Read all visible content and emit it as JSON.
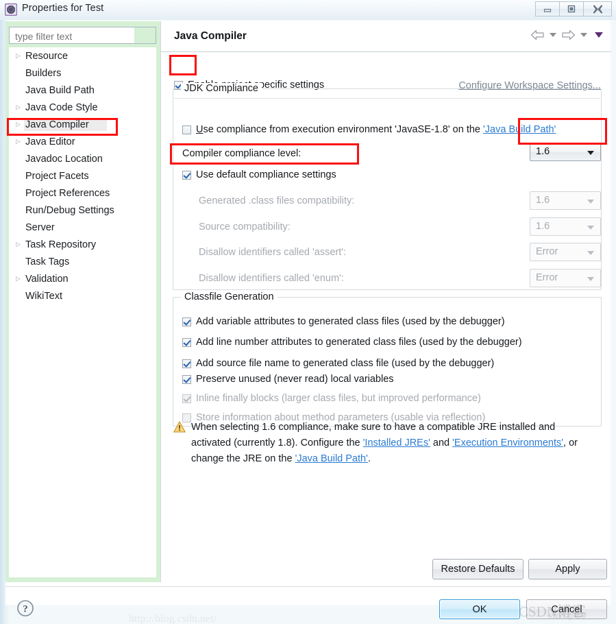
{
  "window": {
    "title": "Properties for Test",
    "icon": "eclipse-properties-icon",
    "minimize_label": "–",
    "maximize_label": "❐",
    "close_label": "✖"
  },
  "sidebar": {
    "filter": {
      "value": "",
      "placeholder": "type filter text"
    },
    "items": [
      {
        "label": "Resource",
        "expandable": true,
        "selected": false
      },
      {
        "label": "Builders",
        "expandable": false,
        "selected": false
      },
      {
        "label": "Java Build Path",
        "expandable": false,
        "selected": false
      },
      {
        "label": "Java Code Style",
        "expandable": true,
        "selected": false
      },
      {
        "label": "Java Compiler",
        "expandable": true,
        "selected": true
      },
      {
        "label": "Java Editor",
        "expandable": true,
        "selected": false
      },
      {
        "label": "Javadoc Location",
        "expandable": false,
        "selected": false
      },
      {
        "label": "Project Facets",
        "expandable": false,
        "selected": false
      },
      {
        "label": "Project References",
        "expandable": false,
        "selected": false
      },
      {
        "label": "Run/Debug Settings",
        "expandable": false,
        "selected": false
      },
      {
        "label": "Server",
        "expandable": false,
        "selected": false
      },
      {
        "label": "Task Repository",
        "expandable": true,
        "selected": false
      },
      {
        "label": "Task Tags",
        "expandable": false,
        "selected": false
      },
      {
        "label": "Validation",
        "expandable": true,
        "selected": false
      },
      {
        "label": "WikiText",
        "expandable": false,
        "selected": false
      }
    ]
  },
  "page": {
    "title": "Java Compiler",
    "enable_project_specific": {
      "label_pre": "E",
      "label_underline": "n",
      "label_post": "able project specific settings",
      "label_full": "Enable project specific settings",
      "checked": true
    },
    "configure_workspace_link": "Configure Workspace Settings..."
  },
  "jdk_compliance": {
    "group_title": "JDK Compliance",
    "use_execution_env": {
      "text_before": "se compliance from execution environment 'JavaSE-1.8' on the ",
      "underlined_first": "U",
      "link": "'Java Build Path'",
      "checked": false
    },
    "compiler_compliance_level": {
      "label": "Compiler compliance level:",
      "value": "1.6",
      "enabled": true
    },
    "use_default_compliance": {
      "label": "Use default compliance settings",
      "checked": true
    },
    "fields": [
      {
        "label": "Generated .class files compatibility:",
        "value": "1.6",
        "enabled": false
      },
      {
        "label": "Source compatibility:",
        "value": "1.6",
        "enabled": false
      },
      {
        "label": "Disallow identifiers called 'assert':",
        "value": "Error",
        "enabled": false
      },
      {
        "label": "Disallow identifiers called 'enum':",
        "value": "Error",
        "enabled": false
      }
    ]
  },
  "classfile_generation": {
    "group_title": "Classfile Generation",
    "options": [
      {
        "label": "Add variable attributes to generated class files (used by the debugger)",
        "checked": true,
        "enabled": true
      },
      {
        "label": "Add line number attributes to generated class files (used by the debugger)",
        "checked": true,
        "enabled": true
      },
      {
        "label": "Add source file name to generated class file (used by the debugger)",
        "checked": true,
        "enabled": true
      },
      {
        "label": "Preserve unused (never read) local variables",
        "checked": true,
        "enabled": true
      },
      {
        "label": "Inline finally blocks (larger class files, but improved performance)",
        "checked": true,
        "enabled": false
      },
      {
        "label": "Store information about method parameters (usable via reflection)",
        "checked": false,
        "enabled": false
      }
    ]
  },
  "warning": {
    "icon": "warning-triangle-icon",
    "part1": "When selecting 1.6 compliance, make sure to have a compatible JRE installed and activated (currently 1.8). Configure the ",
    "link1": "'Installed JREs'",
    "part2": " and ",
    "link2": "'Execution Environments'",
    "part3": ", or change the JRE on the ",
    "link3": "'Java Build Path'",
    "part4": "."
  },
  "buttons": {
    "restore_defaults": "Restore Defaults",
    "apply": "Apply",
    "ok": "OK",
    "cancel": "Cancel",
    "help": "?"
  },
  "watermark": {
    "brand": "CSDN博客",
    "handle": "SSDN @哈子",
    "url": "http://blog.csdn.net/"
  },
  "highlights": {
    "color": "#fb0f0f"
  }
}
